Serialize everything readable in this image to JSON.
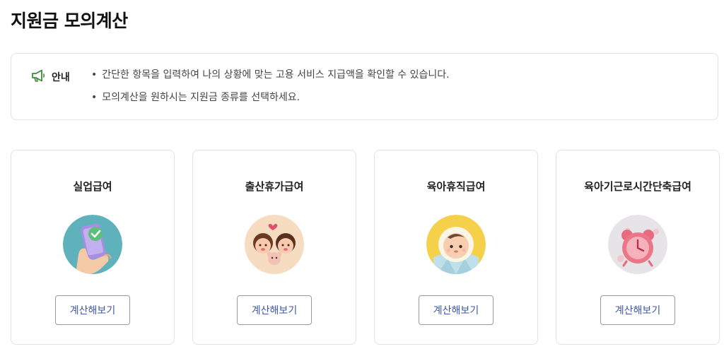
{
  "page": {
    "title": "지원금 모의계산"
  },
  "notice": {
    "icon": "megaphone-icon",
    "label": "안내",
    "items": [
      "간단한 항목을 입력하여 나의 상황에 맞는 고용 서비스 지급액을 확인할 수 있습니다.",
      "모의계산을 원하시는 지원금 종류를 선택하세요."
    ]
  },
  "cards": [
    {
      "title": "실업급여",
      "button": "계산해보기",
      "icon": "phone-check-icon"
    },
    {
      "title": "출산휴가급여",
      "button": "계산해보기",
      "icon": "parents-baby-icon"
    },
    {
      "title": "육아휴직급여",
      "button": "계산해보기",
      "icon": "baby-icon"
    },
    {
      "title": "육아기근로시간단축급여",
      "button": "계산해보기",
      "icon": "alarm-clock-icon"
    }
  ],
  "colors": {
    "accent": "#3e58a8",
    "notice_icon": "#3f8a3a",
    "border": "#e2e2e2"
  }
}
